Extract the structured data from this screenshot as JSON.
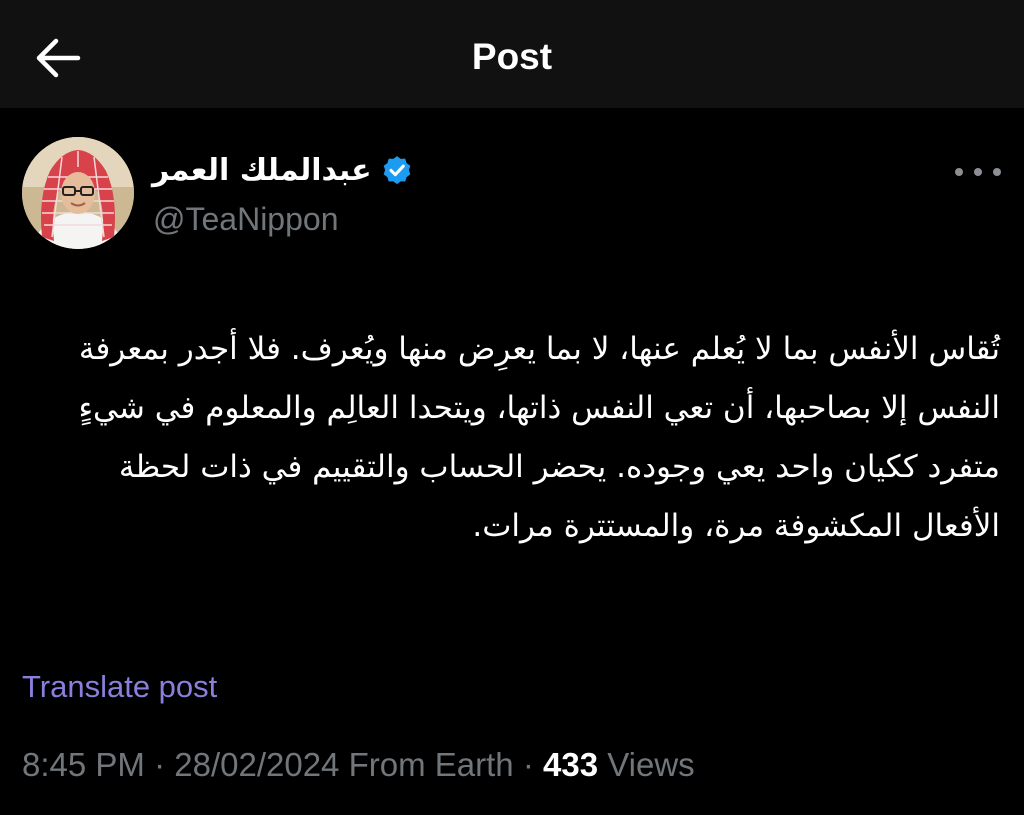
{
  "header": {
    "title": "Post",
    "back_icon": "arrow-left-icon"
  },
  "author": {
    "display_name": "عبدالملك العمر",
    "handle": "@TeaNippon",
    "verified_icon": "verified-badge-icon",
    "verified_color": "#1d9bf0"
  },
  "post": {
    "text": "تُقاس الأنفس بما لا يُعلم عنها، لا بما يعرِض منها ويُعرف. فلا أجدر بمعرفة النفس إلا بصاحبها، أن تعي النفس ذاتها، ويتحدا العالِم والمعلوم في شيءٍ متفرد ككيان واحد يعي وجوده. يحضر الحساب والتقييم في ذات لحظة الأفعال المكشوفة مرة، والمستترة مرات.",
    "translate_label": "Translate post"
  },
  "meta": {
    "time": "8:45 PM",
    "separator": "·",
    "date": "28/02/2024",
    "source": "From Earth",
    "views_count": "433",
    "views_label": "Views"
  },
  "colors": {
    "background": "#000000",
    "header_background": "#111111",
    "secondary_text": "#71767b",
    "translate_link": "#8a7fdb"
  }
}
